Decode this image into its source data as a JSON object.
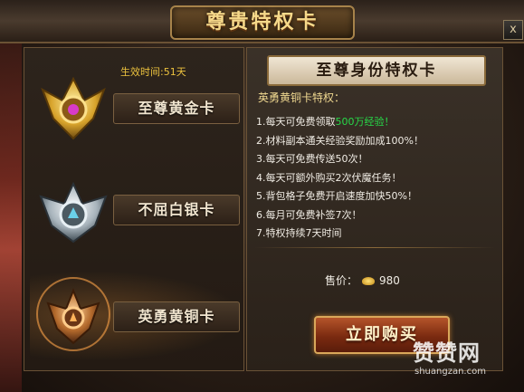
{
  "window": {
    "title": "尊贵特权卡",
    "close_label": "x"
  },
  "cards": [
    {
      "label": "至尊黄金卡",
      "effective": "生效时间:51天",
      "tier": "gold"
    },
    {
      "label": "不屈白银卡",
      "effective": "",
      "tier": "silver"
    },
    {
      "label": "英勇黄铜卡",
      "effective": "",
      "tier": "bronze",
      "selected": true
    }
  ],
  "detail": {
    "header": "至尊身份特权卡",
    "subtitle": "英勇黄铜卡特权：",
    "privileges": [
      {
        "pre": "1.每天可免费领取",
        "hl": "500万经验！",
        "post": ""
      },
      {
        "pre": "2.材料副本通关经验奖励加成100%！",
        "hl": "",
        "post": ""
      },
      {
        "pre": "3.每天可免费传送50次！",
        "hl": "",
        "post": ""
      },
      {
        "pre": "4.每天可额外购买2次伏魔任务！",
        "hl": "",
        "post": ""
      },
      {
        "pre": "5.背包格子免费开启速度加快50%！",
        "hl": "",
        "post": ""
      },
      {
        "pre": "6.每月可免费补签7次！",
        "hl": "",
        "post": ""
      },
      {
        "pre": "7.特权持续7天时间",
        "hl": "",
        "post": ""
      }
    ],
    "price_label": "售价：",
    "price_value": "980",
    "buy_label": "立即购买"
  },
  "watermark": {
    "cn": "赞赞网",
    "url": "shuangzan.com"
  },
  "colors": {
    "highlight": "#27d948",
    "gold_text": "#f6d98a",
    "effective": "#ecc23e"
  }
}
